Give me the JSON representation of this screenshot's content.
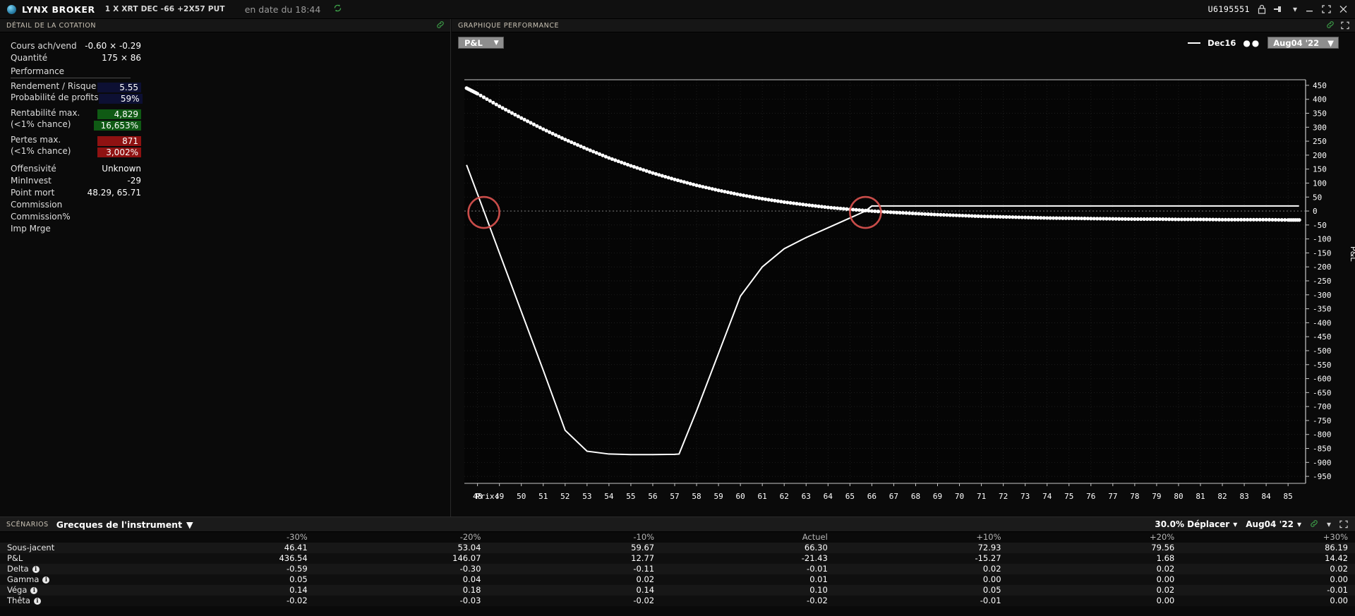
{
  "titlebar": {
    "brand": "LYNX BROKER",
    "contract": "1 X XRT DEC  -66  +2X57 PUT",
    "as_of": "en date du 18:44",
    "refresh_icon": "refresh-icon",
    "user_id": "U6195551",
    "lock_icon": "lock-icon",
    "pin_icon": "pin-icon",
    "pin_caret": "▾",
    "minimize_icon": "—",
    "maximize_icon": "⤡",
    "close_icon": "✕"
  },
  "left_panel": {
    "header": "DÉTAIL DE LA COTATION",
    "link_icon": "link-icon",
    "quote": [
      {
        "label": "Cours ach/vend",
        "value": "-0.60 × -0.29"
      },
      {
        "label": "Quantité",
        "value": "175 × 86"
      }
    ],
    "performance_title": "Performance",
    "performance": [
      {
        "label": "Rendement / Risque",
        "value": "5.55",
        "style": "navy"
      },
      {
        "label": "Probabilité de profits",
        "value": "59%",
        "style": "navy"
      }
    ],
    "max_profit": {
      "label": "Rentabilité max.",
      "value": "4,829",
      "sub_label": "(<1% chance)",
      "sub_value": "16,653%",
      "style": "green"
    },
    "max_loss": {
      "label": "Pertes max.",
      "value": "871",
      "sub_label": "(<1% chance)",
      "sub_value": "3,002%",
      "style": "red"
    },
    "metrics": [
      {
        "label": "Offensivité",
        "value": "Unknown"
      },
      {
        "label": "MinInvest",
        "value": "-29"
      },
      {
        "label": "Point mort",
        "value": "48.29, 65.71"
      },
      {
        "label": "Commission",
        "value": ""
      },
      {
        "label": "Commission%",
        "value": ""
      },
      {
        "label": "Imp Mrge",
        "value": ""
      }
    ]
  },
  "chart_panel": {
    "header": "GRAPHIQUE PERFORMANCE",
    "link_icon": "link-icon",
    "expand_icon": "expand-icon",
    "series_selector": {
      "label": "P&L",
      "caret": "▼"
    },
    "legend": {
      "solid": {
        "label": "Dec16",
        "marker": "solid-line"
      },
      "dotted": {
        "label": "Aug04 '22",
        "marker": "dotted-line",
        "caret": "▼"
      }
    }
  },
  "chart_data": {
    "type": "line",
    "title": "GRAPHIQUE PERFORMANCE",
    "xlabel": "Prix:",
    "ylabel": "P&L",
    "xlim": [
      47.4,
      85.8
    ],
    "ylim": [
      -975,
      470
    ],
    "x_ticks": [
      48,
      49,
      50,
      51,
      52,
      53,
      54,
      55,
      56,
      57,
      58,
      59,
      60,
      61,
      62,
      63,
      64,
      65,
      66,
      67,
      68,
      69,
      70,
      71,
      72,
      73,
      74,
      75,
      76,
      77,
      78,
      79,
      80,
      81,
      82,
      83,
      84,
      85
    ],
    "y_ticks": [
      450,
      400,
      350,
      300,
      250,
      200,
      150,
      100,
      50,
      0,
      -50,
      -100,
      -150,
      -200,
      -250,
      -300,
      -350,
      -400,
      -450,
      -500,
      -550,
      -600,
      -650,
      -700,
      -750,
      -800,
      -850,
      -900,
      -950
    ],
    "grid": true,
    "legend_position": "top-right",
    "zero_line": 0,
    "breakeven_markers": [
      48.29,
      65.71
    ],
    "series": [
      {
        "name": "Dec16",
        "style": "solid",
        "points": [
          [
            47.5,
            165
          ],
          [
            48.29,
            0
          ],
          [
            49,
            -150
          ],
          [
            50,
            -360
          ],
          [
            51,
            -570
          ],
          [
            52,
            -785
          ],
          [
            53,
            -860
          ],
          [
            54,
            -870
          ],
          [
            55,
            -872
          ],
          [
            56,
            -872
          ],
          [
            57,
            -871
          ],
          [
            57.2,
            -870
          ],
          [
            58,
            -715
          ],
          [
            59,
            -510
          ],
          [
            60,
            -305
          ],
          [
            61,
            -200
          ],
          [
            62,
            -135
          ],
          [
            63,
            -95
          ],
          [
            64,
            -60
          ],
          [
            65,
            -25
          ],
          [
            65.71,
            0
          ],
          [
            66,
            18
          ],
          [
            67,
            18
          ],
          [
            70,
            18
          ],
          [
            75,
            18
          ],
          [
            80,
            18
          ],
          [
            85.5,
            18
          ]
        ]
      },
      {
        "name": "Aug04 '22",
        "style": "dotted",
        "points": [
          [
            47.5,
            440
          ],
          [
            48,
            420
          ],
          [
            49,
            375
          ],
          [
            50,
            333
          ],
          [
            51,
            293
          ],
          [
            52,
            256
          ],
          [
            53,
            222
          ],
          [
            54,
            190
          ],
          [
            55,
            162
          ],
          [
            56,
            136
          ],
          [
            57,
            113
          ],
          [
            58,
            92
          ],
          [
            59,
            74
          ],
          [
            60,
            58
          ],
          [
            61,
            44
          ],
          [
            62,
            32
          ],
          [
            63,
            22
          ],
          [
            64,
            13
          ],
          [
            65,
            6
          ],
          [
            66,
            0
          ],
          [
            67,
            -5
          ],
          [
            68,
            -9
          ],
          [
            69,
            -13
          ],
          [
            70,
            -16
          ],
          [
            71,
            -19
          ],
          [
            72,
            -21
          ],
          [
            73,
            -23
          ],
          [
            74,
            -25
          ],
          [
            75,
            -26
          ],
          [
            76,
            -27
          ],
          [
            77,
            -28
          ],
          [
            78,
            -29
          ],
          [
            79,
            -29
          ],
          [
            80,
            -30
          ],
          [
            81,
            -30
          ],
          [
            82,
            -31
          ],
          [
            83,
            -31
          ],
          [
            84,
            -31
          ],
          [
            85,
            -32
          ],
          [
            85.6,
            -32
          ]
        ]
      }
    ],
    "annotations": [
      {
        "type": "circle",
        "x": 48.29,
        "y": 0,
        "color": "#d9534f",
        "label": "breakeven-low"
      },
      {
        "type": "circle",
        "x": 65.71,
        "y": 0,
        "color": "#d9534f",
        "label": "breakeven-high"
      }
    ]
  },
  "scenarios": {
    "tag": "SCÉNARIOS",
    "selector": {
      "label": "Grecques de l'instrument",
      "caret": "▼"
    },
    "move_control": {
      "label": "30.0% Déplacer",
      "caret": "▾"
    },
    "date_control": {
      "label": "Aug04 '22",
      "caret": "▾"
    },
    "link_icon": "link-icon",
    "caret_icon": "▾",
    "expand_icon": "expand-icon",
    "columns": [
      "",
      "-30%",
      "-20%",
      "-10%",
      "Actuel",
      "+10%",
      "+20%",
      "+30%"
    ],
    "rows": [
      {
        "label": "Sous-jacent",
        "info": false,
        "values": [
          "46.41",
          "53.04",
          "59.67",
          "66.30",
          "72.93",
          "79.56",
          "86.19"
        ]
      },
      {
        "label": "P&L",
        "info": false,
        "values": [
          "436.54",
          "146.07",
          "12.77",
          "-21.43",
          "-15.27",
          "1.68",
          "14.42"
        ]
      },
      {
        "label": "Delta",
        "info": true,
        "values": [
          "-0.59",
          "-0.30",
          "-0.11",
          "-0.01",
          "0.02",
          "0.02",
          "0.02"
        ]
      },
      {
        "label": "Gamma",
        "info": true,
        "values": [
          "0.05",
          "0.04",
          "0.02",
          "0.01",
          "0.00",
          "0.00",
          "0.00"
        ]
      },
      {
        "label": "Véga",
        "info": true,
        "values": [
          "0.14",
          "0.18",
          "0.14",
          "0.10",
          "0.05",
          "0.02",
          "-0.01"
        ]
      },
      {
        "label": "Thêta",
        "info": true,
        "values": [
          "-0.02",
          "-0.03",
          "-0.02",
          "-0.02",
          "-0.01",
          "0.00",
          "0.00"
        ]
      }
    ]
  },
  "colors": {
    "accent_green": "#3ea34a",
    "profit": "#0f5a14",
    "loss": "#8f1212",
    "marker": "#d9534f"
  }
}
